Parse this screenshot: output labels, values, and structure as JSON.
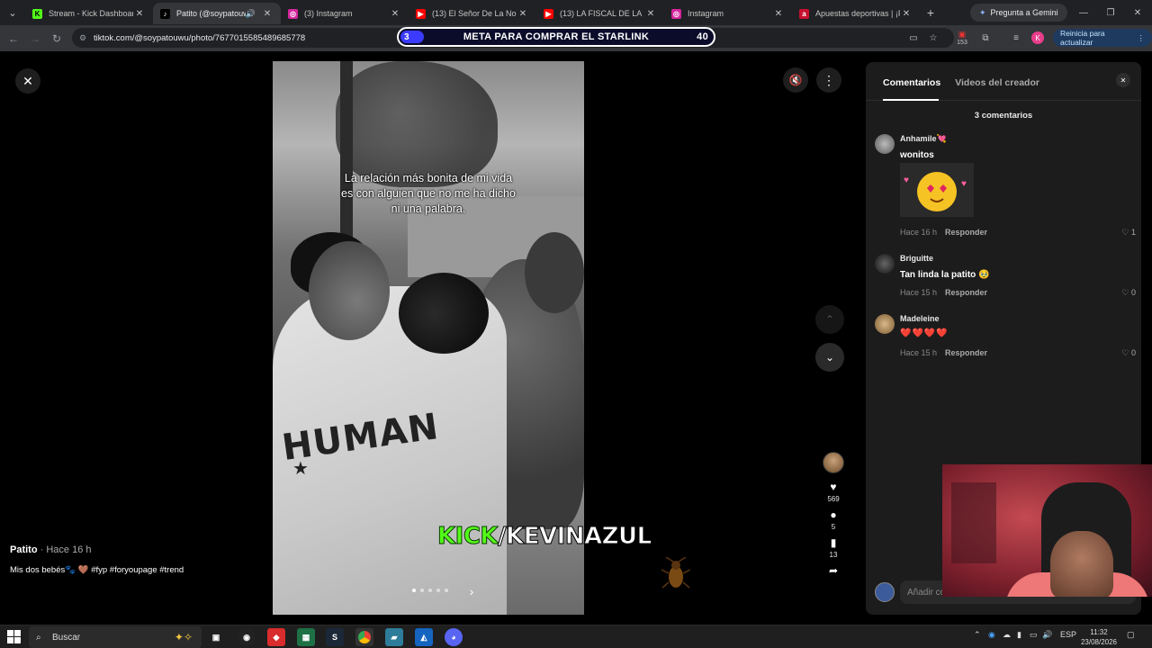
{
  "browser": {
    "tabs": [
      {
        "title": "Stream - Kick Dashboard",
        "fav": "K",
        "fav_bg": "#53fc18",
        "fav_color": "#000",
        "active": false
      },
      {
        "title": "Patito (@soypatouwu)",
        "fav": "♪",
        "fav_bg": "#000",
        "fav_color": "#fff",
        "active": true
      },
      {
        "title": "(3) Instagram",
        "fav": "◎",
        "fav_bg": "#d6249f",
        "fav_color": "#fff",
        "active": false
      },
      {
        "title": "(13) El Señor De La Noche",
        "fav": "▶",
        "fav_bg": "#ff0000",
        "fav_color": "#fff",
        "active": false
      },
      {
        "title": "(13) LA FISCAL DE LA NOC",
        "fav": "▶",
        "fav_bg": "#ff0000",
        "fav_color": "#fff",
        "active": false
      },
      {
        "title": "Instagram",
        "fav": "◎",
        "fav_bg": "#d6249f",
        "fav_color": "#fff",
        "active": false
      },
      {
        "title": "Apuestas deportivas | ¡Parl",
        "fav": "a",
        "fav_bg": "#c8102e",
        "fav_color": "#fff",
        "active": false
      }
    ],
    "gemini_label": "Pregunta a Gemini",
    "url": "tiktok.com/@soypatouwu/photo/7677015585489685778",
    "update_label": "Reinicia para actualizar",
    "ext_badge": "153",
    "profile_initial": "K"
  },
  "overlay_goal": {
    "left_value": "3",
    "label": "META PARA COMPRAR EL STARLINK",
    "right_value": "40"
  },
  "post": {
    "caption_overlay": "La relación más bonita de mi vida es con alguien que no me ha dicho ni una palabra.",
    "hoodie_text": "HUMAN",
    "author": "Patito",
    "time": " · Hace 16 h",
    "description": "Mis dos bebés🐾 🤎 #fyp #foryoupage #trend",
    "likes": "569",
    "comments": "5",
    "saves": "13",
    "dots_total": 5,
    "dots_active": 0
  },
  "stream_overlay": {
    "kick_part": "KICK",
    "channel_part": "/KEVINAZUL"
  },
  "comments_panel": {
    "tab_comments": "Comentarios",
    "tab_creator": "Videos del creador",
    "count_label": "3 comentarios",
    "reply_label": "Responder",
    "add_placeholder": "Añadir comentario...",
    "items": [
      {
        "name": "Anhamile💘",
        "text": "wonitos",
        "time": "Hace 16 h",
        "likes": "1"
      },
      {
        "name": "Briguitte",
        "text": "Tan linda la patito 🥹",
        "time": "Hace 15 h",
        "likes": "0"
      },
      {
        "name": "Madeleine",
        "text": "❤️❤️❤️❤️",
        "time": "Hace 15 h",
        "likes": "0"
      }
    ]
  },
  "taskbar": {
    "search_placeholder": "Buscar",
    "lang": "ESP",
    "time": "11:32",
    "date": "23/08/2026"
  }
}
